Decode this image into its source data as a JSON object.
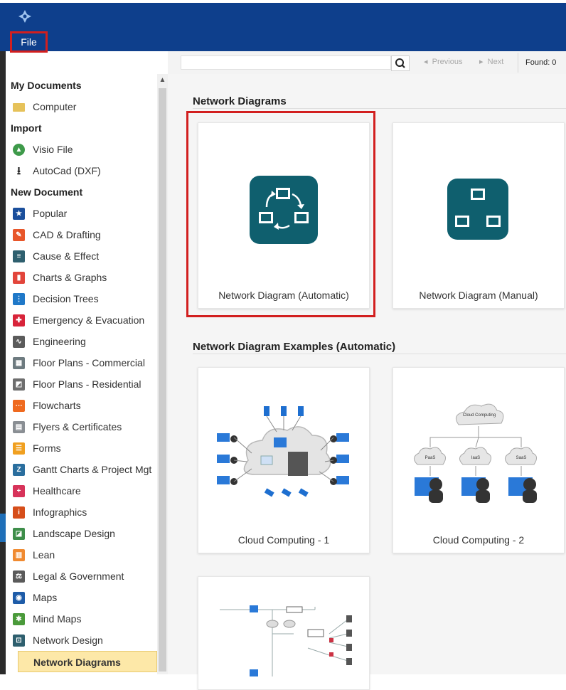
{
  "titlebar": {
    "file_label": "File"
  },
  "search": {
    "placeholder": "",
    "previous_label": "Previous",
    "next_label": "Next",
    "found_label": "Found: 0"
  },
  "sidebar": {
    "my_documents": "My Documents",
    "computer": "Computer",
    "import": "Import",
    "visio": "Visio File",
    "autocad": "AutoCad (DXF)",
    "new_document": "New Document",
    "items": [
      {
        "label": "Popular",
        "icon": "star-icon",
        "color": "#1b4f9c",
        "glyph": "★"
      },
      {
        "label": "CAD & Drafting",
        "icon": "cad-icon",
        "color": "#e8562a",
        "glyph": "✎"
      },
      {
        "label": "Cause & Effect",
        "icon": "cause-effect-icon",
        "color": "#2e5f6e",
        "glyph": "≡"
      },
      {
        "label": "Charts & Graphs",
        "icon": "chart-icon",
        "color": "#e2453b",
        "glyph": "▮"
      },
      {
        "label": "Decision Trees",
        "icon": "decision-tree-icon",
        "color": "#1f78c8",
        "glyph": "⋮"
      },
      {
        "label": "Emergency & Evacuation",
        "icon": "emergency-icon",
        "color": "#d8243a",
        "glyph": "✚"
      },
      {
        "label": "Engineering",
        "icon": "engineering-icon",
        "color": "#5b5b5b",
        "glyph": "∿"
      },
      {
        "label": "Floor Plans - Commercial",
        "icon": "floor-plan-commercial-icon",
        "color": "#6e7b80",
        "glyph": "▦"
      },
      {
        "label": "Floor Plans - Residential",
        "icon": "floor-plan-residential-icon",
        "color": "#6e6e6e",
        "glyph": "◩"
      },
      {
        "label": "Flowcharts",
        "icon": "flowchart-icon",
        "color": "#ef6a1f",
        "glyph": "⋯"
      },
      {
        "label": "Flyers & Certificates",
        "icon": "flyer-icon",
        "color": "#8a8f94",
        "glyph": "▤"
      },
      {
        "label": "Forms",
        "icon": "forms-icon",
        "color": "#f0a020",
        "glyph": "☰"
      },
      {
        "label": "Gantt Charts & Project Mgt",
        "icon": "gantt-icon",
        "color": "#2a6e9e",
        "glyph": "Z"
      },
      {
        "label": "Healthcare",
        "icon": "healthcare-icon",
        "color": "#d7335a",
        "glyph": "+"
      },
      {
        "label": "Infographics",
        "icon": "infographics-icon",
        "color": "#d64e1a",
        "glyph": "i"
      },
      {
        "label": "Landscape Design",
        "icon": "landscape-icon",
        "color": "#3e8e4a",
        "glyph": "◪"
      },
      {
        "label": "Lean",
        "icon": "lean-icon",
        "color": "#f08a30",
        "glyph": "▥"
      },
      {
        "label": "Legal & Government",
        "icon": "legal-icon",
        "color": "#5a5a5a",
        "glyph": "⚖"
      },
      {
        "label": "Maps",
        "icon": "maps-icon",
        "color": "#1e5ca8",
        "glyph": "◉"
      },
      {
        "label": "Mind Maps",
        "icon": "mind-map-icon",
        "color": "#4a9a3a",
        "glyph": "✱"
      },
      {
        "label": "Network Design",
        "icon": "network-design-icon",
        "color": "#2e5f6e",
        "glyph": "⊡"
      }
    ],
    "active_item": "Network Diagrams"
  },
  "main": {
    "section1_title": "Network Diagrams",
    "card_automatic": "Network Diagram (Automatic)",
    "card_manual": "Network Diagram (Manual)",
    "section2_title": "Network Diagram Examples (Automatic)",
    "card_cloud1": "Cloud Computing - 1",
    "card_cloud2": "Cloud Computing - 2",
    "cloud_caption": "Cloud Computing",
    "cloud_tags": [
      "PaaS",
      "IaaS",
      "SaaS"
    ]
  },
  "colors": {
    "titlebar": "#0e3f8c",
    "highlight": "#d21f1f",
    "tile": "#0f5f6e",
    "active_bg": "#fde8a8"
  }
}
